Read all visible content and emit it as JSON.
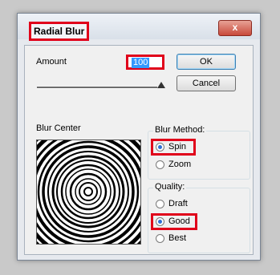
{
  "dialog": {
    "title": "Radial Blur",
    "close_symbol": "x"
  },
  "amount": {
    "label": "Amount",
    "value": "100",
    "slider_level": 1.0
  },
  "buttons": {
    "ok": "OK",
    "cancel": "Cancel"
  },
  "blur_center": {
    "label": "Blur Center"
  },
  "blur_method": {
    "label": "Blur Method:",
    "options": [
      "Spin",
      "Zoom"
    ],
    "selected": "Spin"
  },
  "quality": {
    "label": "Quality:",
    "options": [
      "Draft",
      "Good",
      "Best"
    ],
    "selected": "Good"
  },
  "colors": {
    "highlight": "#e0001a",
    "radio_dot": "#2d6ed6",
    "selection": "#3399ff"
  }
}
